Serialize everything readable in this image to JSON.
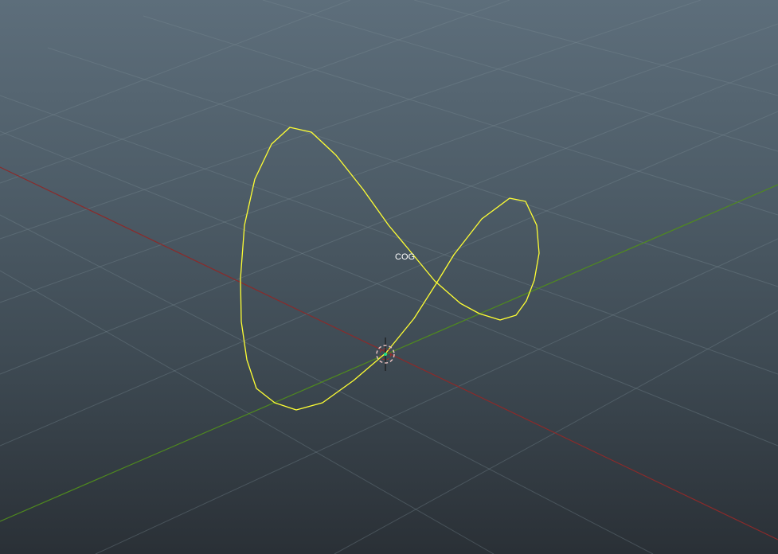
{
  "viewport": {
    "object_label": "COG",
    "selected_curve_color": "#ffff33",
    "x_axis_color": "#8b2a2a",
    "y_axis_color": "#4f8a1e",
    "grid_color": "#6b7b86",
    "background_top": "#5d6e7b",
    "background_bottom": "#2a3036",
    "manipulator_center_color": "#22dd88",
    "manipulator_ring_color": "#e8c0c0",
    "icons": [
      "pivot-manipulator-icon"
    ]
  }
}
